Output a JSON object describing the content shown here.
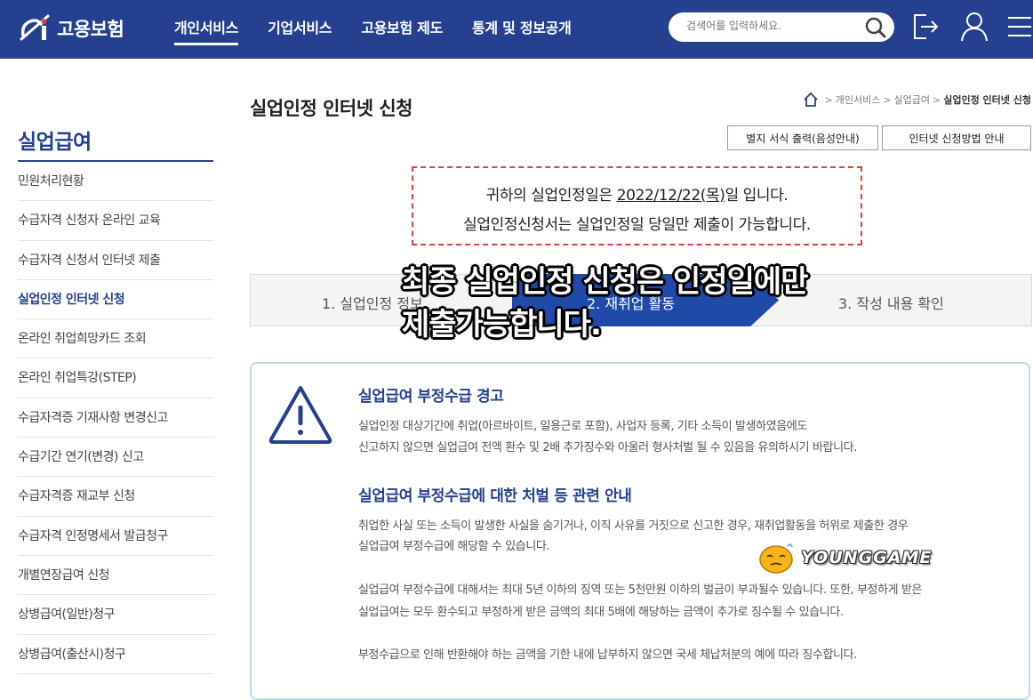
{
  "header": {
    "logo_text": "고용보험",
    "nav": [
      "개인서비스",
      "기업서비스",
      "고용보험 제도",
      "통계 및 정보공개"
    ],
    "search_placeholder": "검색어를 입력하세요."
  },
  "sidebar": {
    "title": "실업급여",
    "items": [
      "민원처리현황",
      "수급자격 신청자 온라인 교육",
      "수급자격 신청서 인터넷 제출",
      "실업인정 인터넷 신청",
      "온라인 취업희망카드 조회",
      "온라인 취업특강(STEP)",
      "수급자격증 기재사항 변경신고",
      "수급기간 연기(변경) 신고",
      "수급자격증 재교부 신청",
      "수급자격 인정명세서 발급청구",
      "개별연장급여 신청",
      "상병급여(일반)청구",
      "상병급여(출산시)청구"
    ],
    "active_index": 3
  },
  "main": {
    "title": "실업인정 인터넷 신청",
    "breadcrumb": [
      "개인서비스",
      "실업급여",
      "실업인정 인터넷 신청"
    ],
    "buttons": [
      "별지 서식 출력(음성안내)",
      "인터넷 신청방법 안내"
    ],
    "notice": {
      "line1_prefix": "귀하의 실업인정일은 ",
      "date": "2022/12/22(목)",
      "line1_suffix": "일 입니다.",
      "line2": "실업인정신청서는 실업인정일 당일만 제출이 가능합니다."
    },
    "steps": [
      "1. 실업인정 정보",
      "2. 재취업 활동",
      "3. 작성 내용 확인"
    ],
    "active_step": 2,
    "overlay": [
      "최종 실업인정 신청은 인정일에만",
      "제출가능합니다."
    ],
    "warning": {
      "heading1": "실업급여 부정수급 경고",
      "p1": [
        "실업인정 대상기간에 취업(아르바이트, 일용근로 포함), 사업자 등록, 기타 소득이 발생하였음에도",
        "신고하지 않으면 실업급여 전액 환수 및 2배 추가징수와 아울러 형사처벌 될 수 있음을 유의하시기 바랍니다."
      ],
      "heading2": "실업급여 부정수급에 대한 처벌 등 관련 안내",
      "p2": [
        "취업한 사실 또는 소득이 발생한 사실을 숨기거나, 이직 사유를 거짓으로 신고한 경우, 재취업활동을 허위로 제출한 경우",
        "실업급여 부정수급에 해당할 수 있습니다."
      ],
      "p3": [
        "실업급여 부정수급에 대해서는 최대 5년 이하의 징역 또는 5천만원 이하의 벌금이 부과될수 있습니다. 또한, 부정하게 받은",
        "실업급여는 모두 환수되고 부정하게 받은 금액의 최대 5배에 해당하는 금액이 추가로 징수될 수 있습니다."
      ],
      "p4": "부정수급으로 인해 반환해야 하는 금액을 기한 내에 납부하지 않으면 국세 체납처분의 예에 따라 징수합니다."
    }
  },
  "watermark": "YOUNGGAME",
  "colors": {
    "brand": "#24408f",
    "notice_border": "#e04040",
    "warn_border": "#b9dcec",
    "step_active": "#1f4aa8"
  }
}
